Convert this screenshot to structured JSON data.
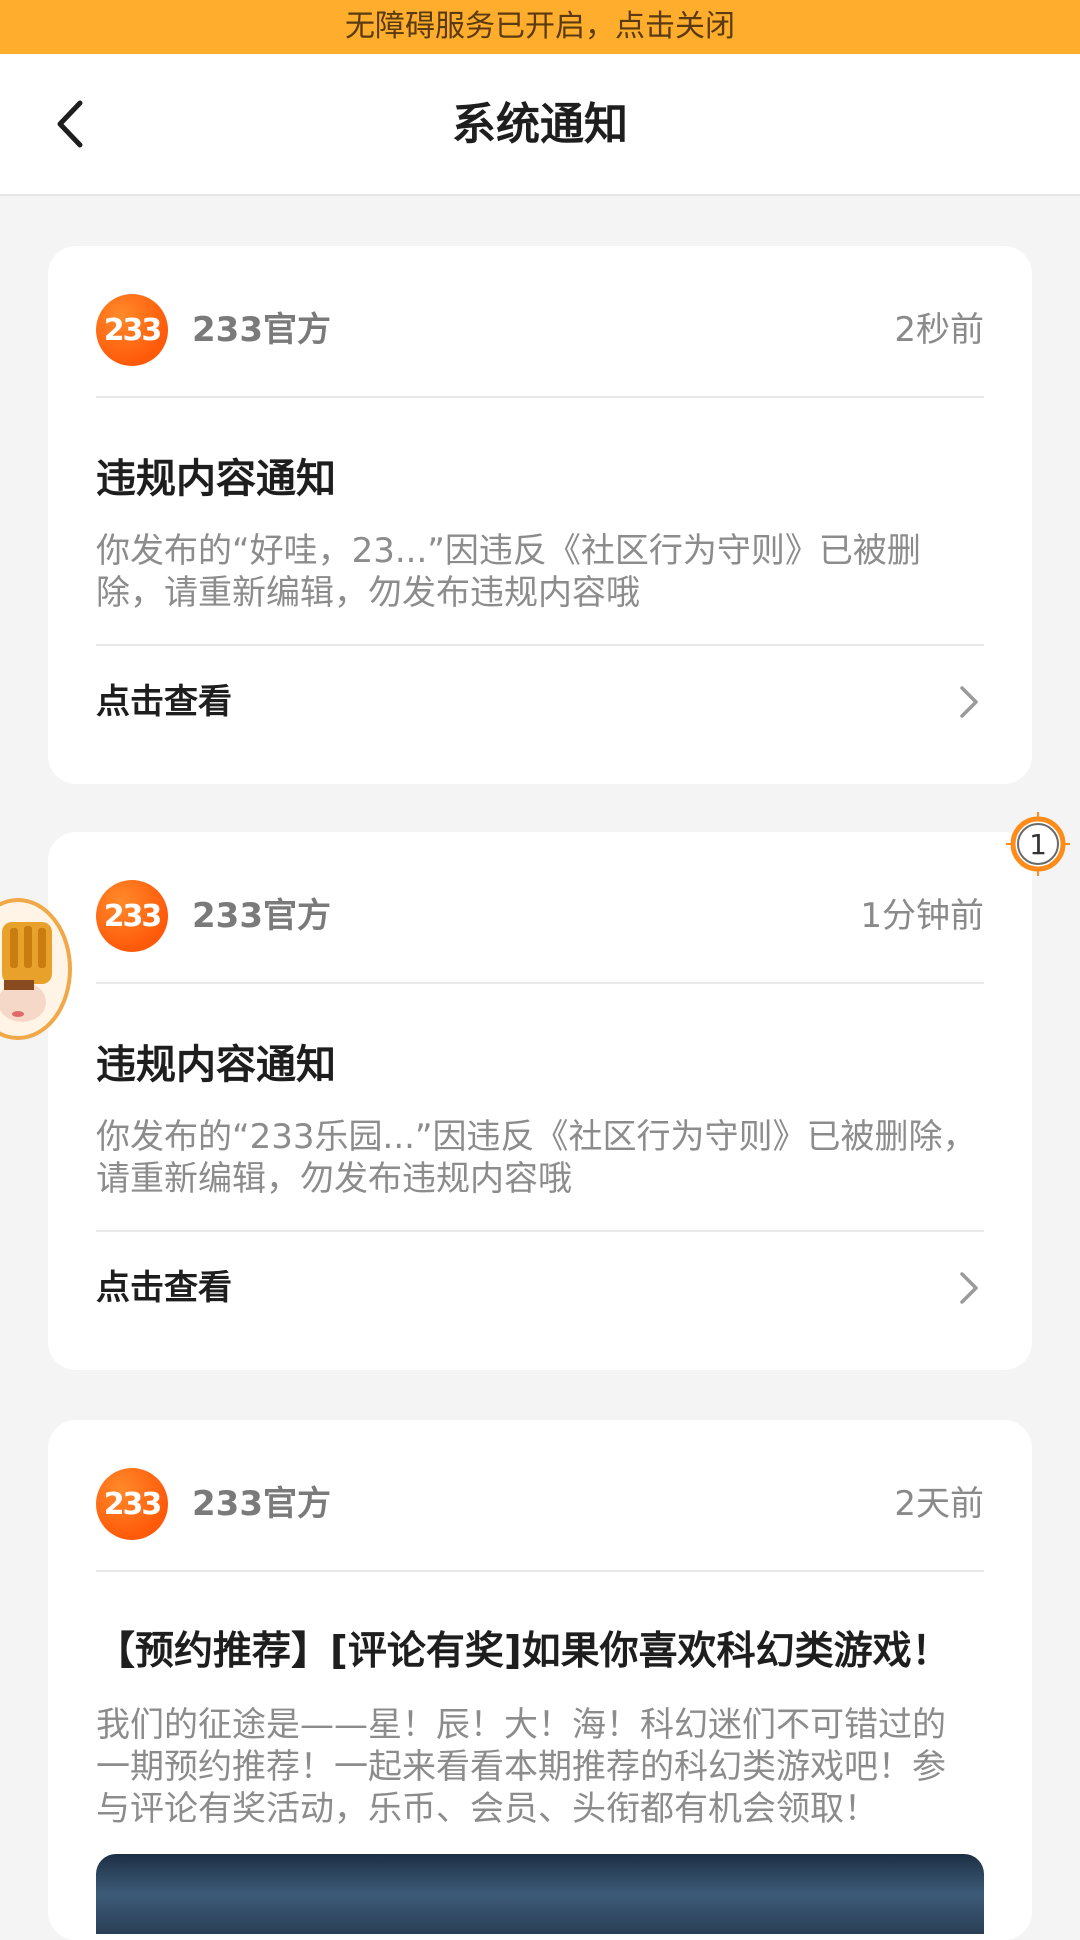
{
  "banner": {
    "text": "无障碍服务已开启，点击关闭"
  },
  "header": {
    "title": "系统通知"
  },
  "notifications": [
    {
      "logo_text": "233",
      "sender": "233官方",
      "time": "2秒前",
      "title": "违规内容通知",
      "body_lines": [
        "你发布的“好哇，23...”因违反《社区行为守则》已被删",
        "除，请重新编辑，勿发布违规内容哦"
      ],
      "action": "点击查看"
    },
    {
      "logo_text": "233",
      "sender": "233官方",
      "time": "1分钟前",
      "title": "违规内容通知",
      "body_lines": [
        "你发布的“233乐园...”因违反《社区行为守则》已被删除，",
        "请重新编辑，勿发布违规内容哦"
      ],
      "action": "点击查看"
    },
    {
      "logo_text": "233",
      "sender": "233官方",
      "time": "2天前",
      "title": "【预约推荐】[评论有奖]如果你喜欢科幻类游戏！",
      "body_lines": [
        "我们的征途是——星！辰！大！海！科幻迷们不可错过的",
        "一期预约推荐！一起来看看本期推荐的科幻类游戏吧！参",
        "与评论有奖活动，乐币、会员、头衔都有机会领取！"
      ]
    }
  ],
  "floating_badge": {
    "text": "1"
  },
  "colors": {
    "banner": "#ffad2c",
    "logo": "#ff6a10",
    "background": "#f4f4f4"
  }
}
